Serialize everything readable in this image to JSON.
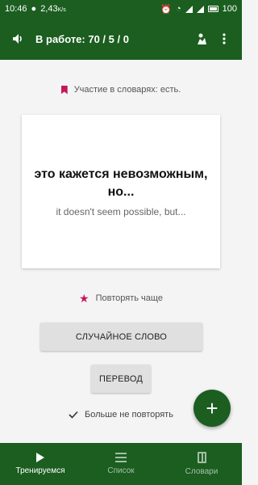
{
  "statusbar": {
    "time": "10:46",
    "data_speed": "2,43",
    "battery": "100"
  },
  "appbar": {
    "title": "В работе: 70 / 5 / 0",
    "icon_left": "speaker-icon",
    "icon_theme": "theme-icon",
    "icon_menu": "more-vert-icon"
  },
  "dictionary_status": "Участие в словарях: есть.",
  "card": {
    "word_ru": "это кажется невозможным, но...",
    "word_en": "it doesn't seem possible, but..."
  },
  "repeat_more": "Повторять чаще",
  "buttons": {
    "random_word": "СЛУЧАЙНОЕ СЛОВО",
    "translate": "ПЕРЕВОД"
  },
  "never_repeat": "Больше не повторять",
  "fab_label": "+",
  "bottom_nav": {
    "items": [
      {
        "label": "Тренируемся",
        "icon": "play-icon",
        "active": true
      },
      {
        "label": "Список",
        "icon": "list-icon",
        "active": false
      },
      {
        "label": "Словари",
        "icon": "book-icon",
        "active": false
      }
    ]
  },
  "colors": {
    "primary": "#1b5e20",
    "accent": "#c2185b",
    "background": "#f4f4f4"
  }
}
